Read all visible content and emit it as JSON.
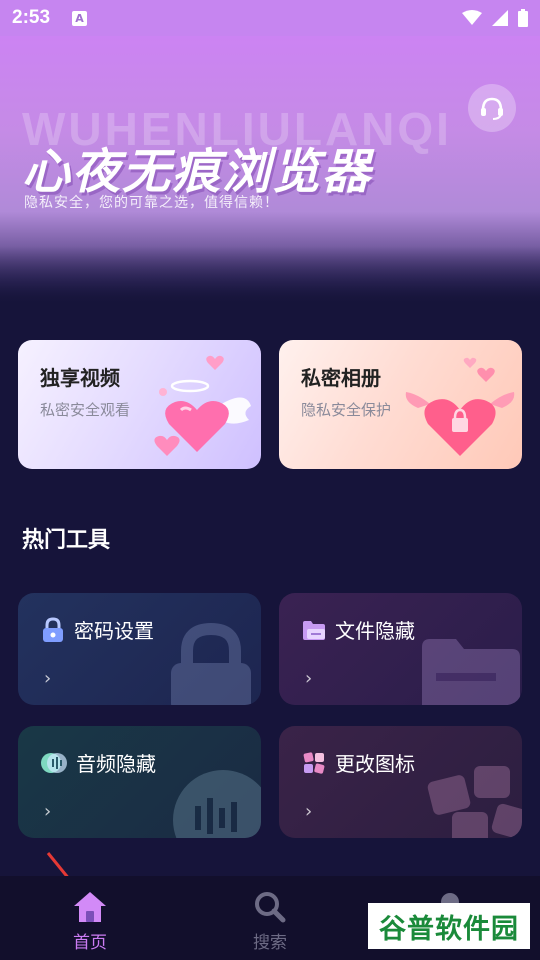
{
  "status_bar": {
    "time": "2:53",
    "notification_badge": "A"
  },
  "hero": {
    "bg_text": "WUHENLIULANQI",
    "title": "心夜无痕浏览器",
    "subtitle": "隐私安全，您的可靠之选，值得信赖！",
    "support_icon": "headset-icon"
  },
  "features": [
    {
      "title": "独享视频",
      "subtitle": "私密安全观看"
    },
    {
      "title": "私密相册",
      "subtitle": "隐私安全保护"
    }
  ],
  "section": {
    "title": "热门工具"
  },
  "tools": [
    {
      "label": "密码设置",
      "arrow": "›",
      "icon": "lock-icon"
    },
    {
      "label": "文件隐藏",
      "arrow": "›",
      "icon": "folder-icon"
    },
    {
      "label": "音频隐藏",
      "arrow": "›",
      "icon": "audio-icon"
    },
    {
      "label": "更改图标",
      "arrow": "›",
      "icon": "grid-icon"
    }
  ],
  "nav": [
    {
      "label": "首页",
      "icon": "home-icon",
      "active": true
    },
    {
      "label": "搜索",
      "icon": "search-icon",
      "active": false
    },
    {
      "label": "",
      "icon": "profile-icon",
      "active": false
    }
  ],
  "watermark": "谷普软件园",
  "colors": {
    "accent": "#cc7cf4",
    "background": "#16143a",
    "hero_top": "#cc83f3"
  }
}
